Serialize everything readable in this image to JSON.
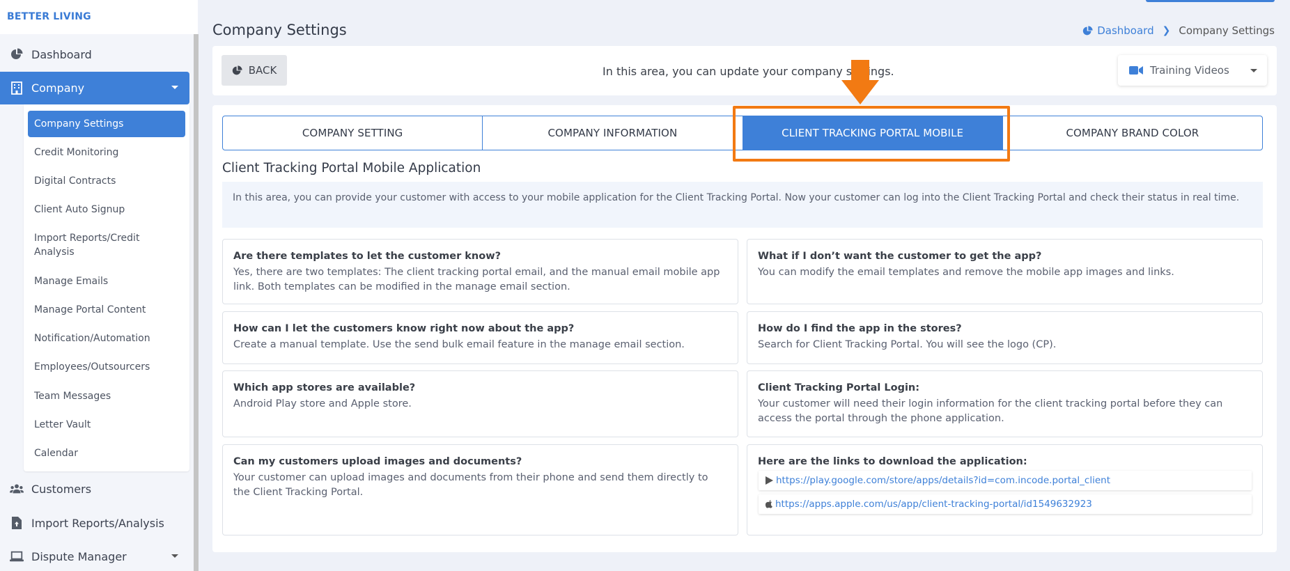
{
  "brand": "BETTER LIVING",
  "sidebar": {
    "items": [
      {
        "label": "Dashboard",
        "icon": "pie-chart-icon"
      },
      {
        "label": "Company",
        "icon": "building-icon"
      },
      {
        "label": "Customers",
        "icon": "users-icon"
      },
      {
        "label": "Import Reports/Analysis",
        "icon": "file-upload-icon"
      },
      {
        "label": "Dispute Manager",
        "icon": "laptop-icon"
      }
    ],
    "submenu": [
      "Company Settings",
      "Credit Monitoring",
      "Digital Contracts",
      "Client Auto Signup",
      "Import Reports/Credit Analysis",
      "Manage Emails",
      "Manage Portal Content",
      "Notification/Automation",
      "Employees/Outsourcers",
      "Team Messages",
      "Letter Vault",
      "Calendar"
    ]
  },
  "page": {
    "title": "Company Settings",
    "breadcrumb": {
      "home": "Dashboard",
      "current": "Company Settings"
    }
  },
  "toolbar": {
    "back_label": "BACK",
    "message": "In this area, you can update your company settings.",
    "training_label": "Training Videos"
  },
  "tabs": [
    {
      "label": "COMPANY SETTING",
      "active": false
    },
    {
      "label": "COMPANY INFORMATION",
      "active": false
    },
    {
      "label": "CLIENT TRACKING PORTAL MOBILE",
      "active": true
    },
    {
      "label": "COMPANY BRAND COLOR",
      "active": false
    }
  ],
  "section": {
    "title": "Client Tracking Portal Mobile Application",
    "info": "In this area, you can provide your customer with access to your mobile application for the Client Tracking Portal. Now your customer can log into the Client Tracking Portal and check their status in real time."
  },
  "faq": [
    {
      "q": "Are there templates to let the customer know?",
      "a": "Yes, there are two templates: The client tracking portal email, and the manual email mobile app link. Both templates can be modified in the manage email section."
    },
    {
      "q": "What if I don’t want the customer to get the app?",
      "a": "You can modify the email templates and remove the mobile app images and links."
    },
    {
      "q": "How can I let the customers know right now about the app?",
      "a": "Create a manual template. Use the send bulk email feature in the manage email section."
    },
    {
      "q": "How do I find the app in the stores?",
      "a": "Search for Client Tracking Portal. You will see the logo (CP)."
    },
    {
      "q": "Which app stores are available?",
      "a": "Android Play store and Apple store."
    },
    {
      "q": "Client Tracking Portal Login:",
      "a": "Your customer will need their login information for the client tracking portal before they can access the portal through the phone application."
    },
    {
      "q": "Can my customers upload images and documents?",
      "a": "Your customer can upload images and documents from their phone and send them directly to the Client Tracking Portal."
    },
    {
      "q": "Here are the links to download the application:",
      "a": ""
    }
  ],
  "links": [
    {
      "icon": "play-store-icon",
      "url": "https://play.google.com/store/apps/details?id=com.incode.portal_client"
    },
    {
      "icon": "apple-icon",
      "url": "https://apps.apple.com/us/app/client-tracking-portal/id1549632923"
    }
  ],
  "colors": {
    "accent": "#3e80d8",
    "annotation": "#f27a13"
  }
}
